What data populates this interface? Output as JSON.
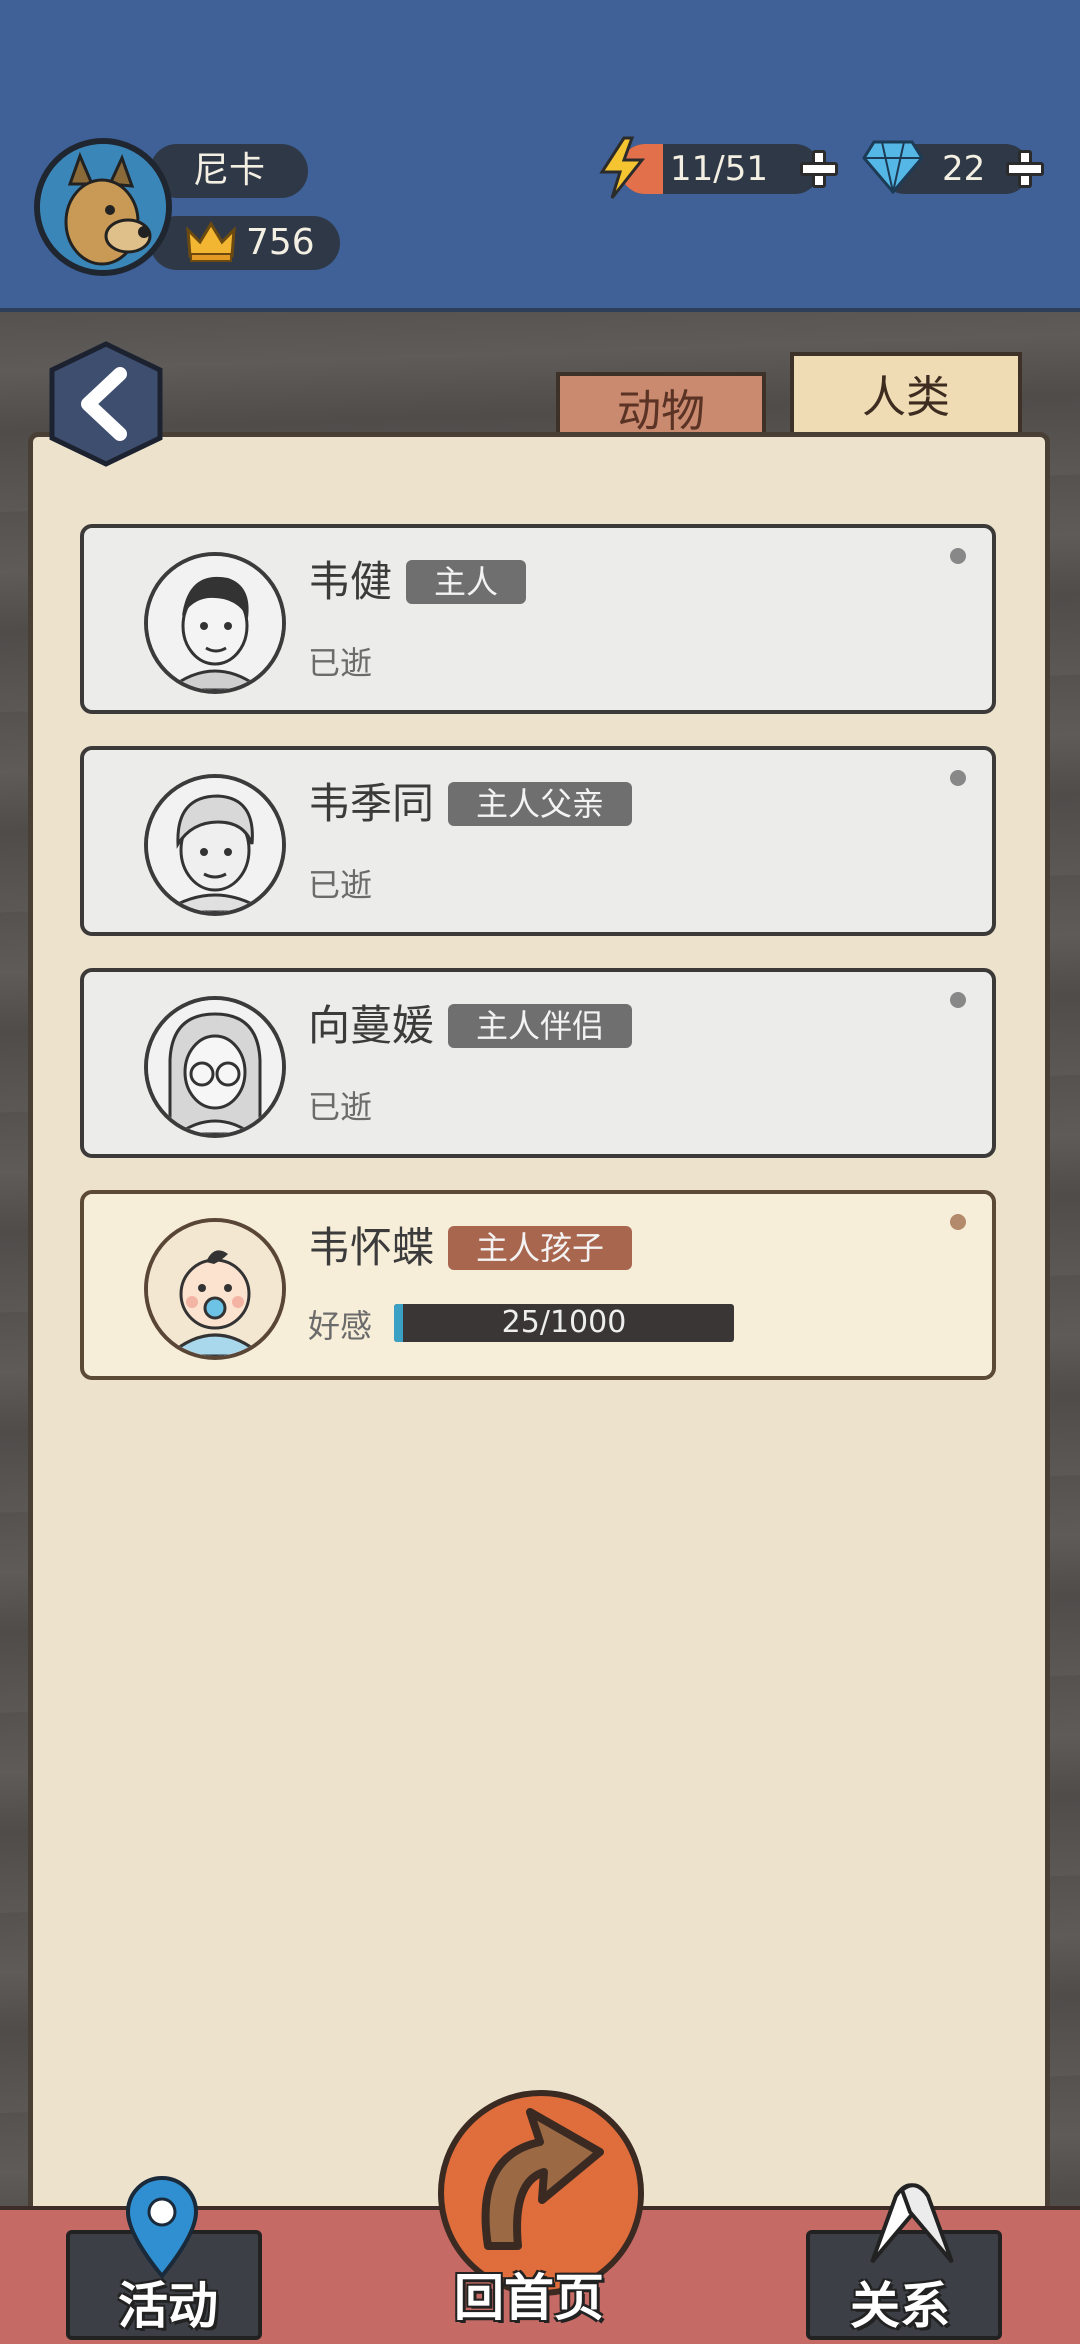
{
  "header": {
    "pet_name": "尼卡",
    "crowns": "756",
    "energy": "11/51",
    "energy_level": 0.216,
    "gems": "22"
  },
  "tabs": [
    {
      "label": "动物",
      "selected": false
    },
    {
      "label": "人类",
      "selected": true
    }
  ],
  "people": [
    {
      "name": "韦健",
      "relation": "主人",
      "status": "已逝"
    },
    {
      "name": "韦季同",
      "relation": "主人父亲",
      "status": "已逝"
    },
    {
      "name": "向蔓媛",
      "relation": "主人伴侣",
      "status": "已逝"
    },
    {
      "name": "韦怀蝶",
      "relation": "主人孩子",
      "favor_label": "好感",
      "favor_text": "25/1000",
      "favor_level": 0.025
    }
  ],
  "nav": {
    "activities": "活动",
    "home": "回首页",
    "relations": "关系"
  },
  "colors": {
    "header_bg": "#3f6198",
    "paper": "#ede2cc",
    "badge_gray": "#6f6f6f",
    "badge_active": "#a9664f",
    "nav_bg": "#c56a64"
  }
}
